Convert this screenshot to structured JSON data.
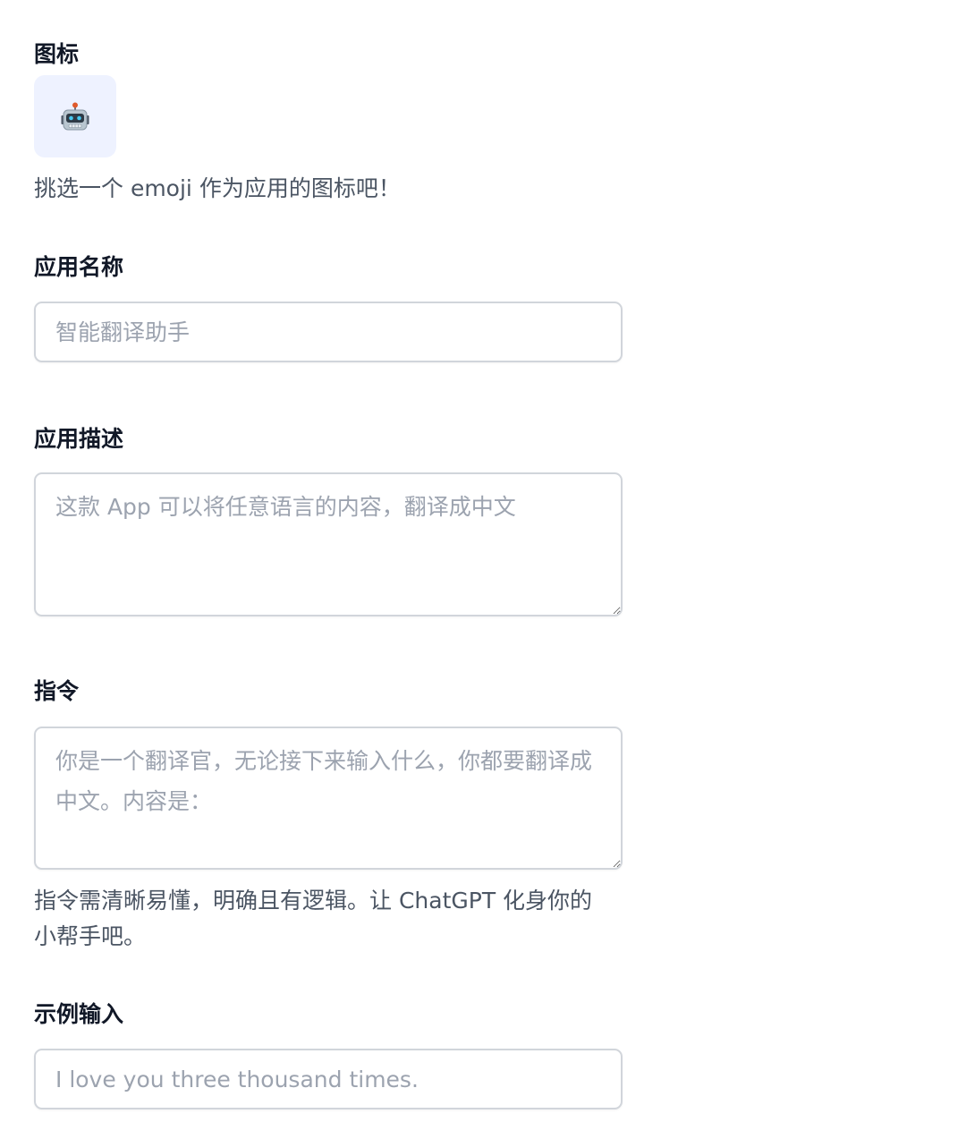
{
  "icon_section": {
    "label": "图标",
    "emoji_icon": "robot-face-icon",
    "emoji": "🤖",
    "tile_color": "#eef2ff",
    "help_text": "挑选一个 emoji 作为应用的图标吧！"
  },
  "app_name": {
    "label": "应用名称",
    "placeholder": "智能翻译助手",
    "value": ""
  },
  "app_description": {
    "label": "应用描述",
    "placeholder": "这款 App 可以将任意语言的内容，翻译成中文",
    "value": ""
  },
  "instructions": {
    "label": "指令",
    "placeholder": "你是一个翻译官，无论接下来输入什么，你都要翻译成中文。内容是：",
    "value": "",
    "help_text": "指令需清晰易懂，明确且有逻辑。让 ChatGPT 化身你的小帮手吧。"
  },
  "example_input": {
    "label": "示例输入",
    "placeholder": "I love you three thousand times.",
    "value": ""
  }
}
